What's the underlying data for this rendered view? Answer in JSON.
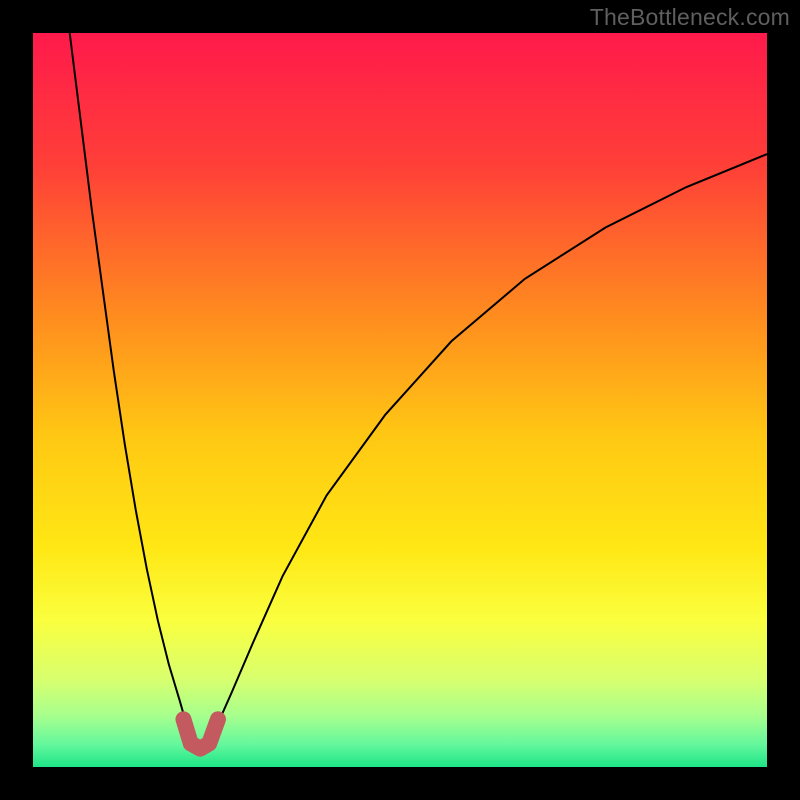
{
  "watermark": "TheBottleneck.com",
  "chart_data": {
    "type": "line",
    "title": "",
    "xlabel": "",
    "ylabel": "",
    "xlim": [
      0,
      100
    ],
    "ylim": [
      0,
      100
    ],
    "gradient_stops": [
      {
        "offset": 0,
        "color": "#ff1a4b"
      },
      {
        "offset": 0.18,
        "color": "#ff3f38"
      },
      {
        "offset": 0.38,
        "color": "#ff8a1f"
      },
      {
        "offset": 0.55,
        "color": "#ffc813"
      },
      {
        "offset": 0.7,
        "color": "#ffe714"
      },
      {
        "offset": 0.8,
        "color": "#faff3e"
      },
      {
        "offset": 0.88,
        "color": "#d8ff6e"
      },
      {
        "offset": 0.93,
        "color": "#a7ff8d"
      },
      {
        "offset": 0.97,
        "color": "#63f79d"
      },
      {
        "offset": 1.0,
        "color": "#1de586"
      }
    ],
    "series": [
      {
        "name": "curve-left",
        "type": "line",
        "stroke": "#000000",
        "stroke_width": 2,
        "x": [
          5.0,
          6.5,
          8.0,
          9.5,
          11.0,
          12.5,
          14.0,
          15.5,
          17.0,
          18.5,
          20.0,
          21.0
        ],
        "y": [
          100.0,
          88.0,
          76.0,
          65.0,
          54.0,
          44.0,
          35.0,
          27.0,
          20.0,
          14.0,
          9.0,
          5.5
        ]
      },
      {
        "name": "curve-right",
        "type": "line",
        "stroke": "#000000",
        "stroke_width": 2,
        "x": [
          25.0,
          27.0,
          30.0,
          34.0,
          40.0,
          48.0,
          57.0,
          67.0,
          78.0,
          89.0,
          100.0
        ],
        "y": [
          5.5,
          10.0,
          17.0,
          26.0,
          37.0,
          48.0,
          58.0,
          66.5,
          73.5,
          79.0,
          83.5
        ]
      },
      {
        "name": "valley-marker",
        "type": "line",
        "stroke": "#c25a5f",
        "stroke_width": 16,
        "linecap": "round",
        "x": [
          20.5,
          21.5,
          22.8,
          24.0,
          25.2
        ],
        "y": [
          6.5,
          3.2,
          2.5,
          3.2,
          6.5
        ]
      }
    ]
  }
}
